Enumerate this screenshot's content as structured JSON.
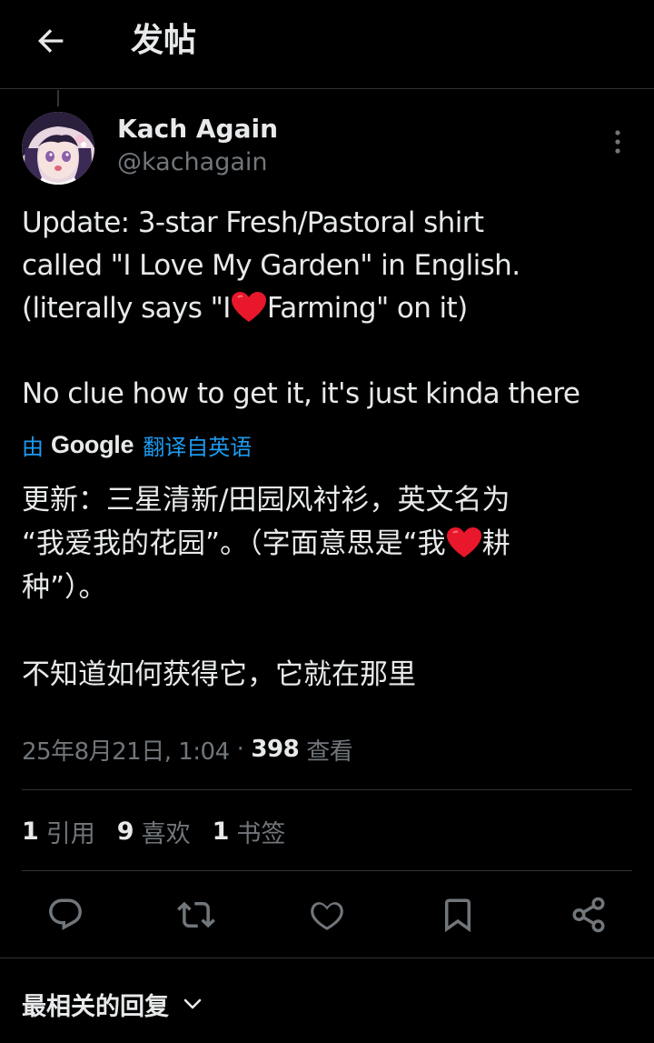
{
  "header": {
    "title": "发帖",
    "back_icon": "arrow-left-icon"
  },
  "author": {
    "name": "Kach Again",
    "handle": "@kachagain"
  },
  "tweet": {
    "lines": [
      "Update: 3-star Fresh/Pastoral shirt",
      "called \"I Love My Garden\" in English.",
      "(literally says \"I",
      "Farming\" on it)",
      "No clue how to get it, it's just kinda there"
    ]
  },
  "translation": {
    "by": "由",
    "provider": "Google",
    "label": "翻译自英语",
    "lines": [
      "更新：三星清新/田园风衬衫，英文名为",
      "“我爱我的花园”。（字面意思是“我",
      "耕",
      "种”）。",
      "不知道如何获得它，它就在那里"
    ]
  },
  "meta": {
    "datetime": "25年8月21日, 1:04",
    "separator": "·",
    "views_count": "398",
    "views_label": "查看"
  },
  "stats": [
    {
      "count": "1",
      "label": "引用"
    },
    {
      "count": "9",
      "label": "喜欢"
    },
    {
      "count": "1",
      "label": "书签"
    }
  ],
  "actions": [
    "reply-icon",
    "retweet-icon",
    "like-icon",
    "bookmark-icon",
    "share-icon"
  ],
  "replies_sort": {
    "label": "最相关的回复"
  },
  "colors": {
    "background": "#000000",
    "text": "#e7e9ea",
    "secondary": "#71767b",
    "accent": "#1d9bf0",
    "divider": "#2f3336",
    "heart": "#e8172b"
  }
}
